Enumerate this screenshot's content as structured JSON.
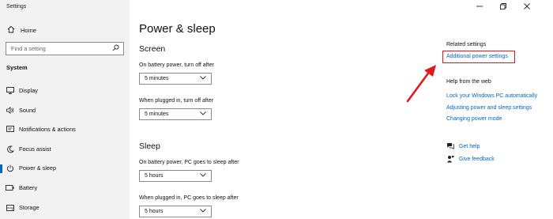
{
  "window": {
    "title": "Settings"
  },
  "sidebar": {
    "home_label": "Home",
    "search_placeholder": "Find a setting",
    "section_label": "System",
    "items": [
      {
        "label": "Display",
        "icon": "display-icon"
      },
      {
        "label": "Sound",
        "icon": "speaker-icon"
      },
      {
        "label": "Notifications & actions",
        "icon": "notification-icon"
      },
      {
        "label": "Focus assist",
        "icon": "moon-icon"
      },
      {
        "label": "Power & sleep",
        "icon": "power-icon",
        "active": true
      },
      {
        "label": "Battery",
        "icon": "battery-icon"
      },
      {
        "label": "Storage",
        "icon": "storage-icon"
      }
    ]
  },
  "main": {
    "title": "Power & sleep",
    "screen": {
      "heading": "Screen",
      "battery_label": "On battery power, turn off after",
      "battery_value": "5 minutes",
      "plugged_label": "When plugged in, turn off after",
      "plugged_value": "5 minutes"
    },
    "sleep": {
      "heading": "Sleep",
      "battery_label": "On battery power, PC goes to sleep after",
      "battery_value": "5 hours",
      "plugged_label": "When plugged in, PC goes to sleep after",
      "plugged_value": "5 hours"
    }
  },
  "related": {
    "title": "Related settings",
    "link": "Additional power settings"
  },
  "help": {
    "title": "Help from the web",
    "links": [
      "Lock your Windows PC automatically",
      "Adjusting power and sleep settings",
      "Changing power mode"
    ],
    "get_help": "Get help",
    "give_feedback": "Give feedback"
  },
  "colors": {
    "accent": "#0067c0",
    "annotation": "#e0191c",
    "sidebar_bg": "#f2f2f2"
  }
}
